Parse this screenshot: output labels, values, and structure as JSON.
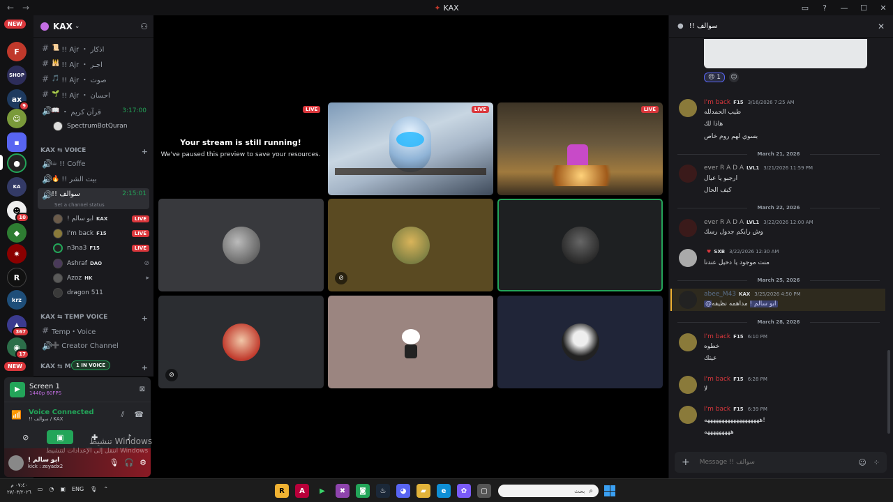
{
  "window": {
    "title": "KAX",
    "back_icon": "←",
    "forward_icon": "→"
  },
  "rail": {
    "new_badge_top": "NEW",
    "new_badge_bottom": "NEW",
    "badges": [
      "9",
      "10",
      "367",
      "17"
    ],
    "letters": [
      "F",
      "R",
      "krz"
    ]
  },
  "guild": {
    "name": "KAX"
  },
  "channels": [
    {
      "label": "!! Ajr ・ اذكار"
    },
    {
      "label": "!! Ajr ・ اجـر"
    },
    {
      "label": "!! Ajr ・ صوت"
    },
    {
      "label": "!! Ajr ・ احسان"
    },
    {
      "label": "・ قرآن كريم",
      "time": "3:17:00"
    }
  ],
  "bot_user": "SpectrumBotQuran",
  "categories": {
    "voice": "KAX ⇆ VOICE",
    "temp": "KAX ⇆ TEMP VOICE",
    "misc": "KAX ⇆ M"
  },
  "voice_channels": [
    {
      "label": "!! Coffe"
    },
    {
      "label": "!! بيت الشر"
    },
    {
      "label": "!! سوالف",
      "time": "2:15:01",
      "status": "Set a channel status"
    }
  ],
  "voice_users": [
    {
      "name": "! ابو سالم",
      "tag": "KAX",
      "badge": "LIVE"
    },
    {
      "name": "I'm back",
      "tag": "F15",
      "badge": "LIVE"
    },
    {
      "name": "n3na3",
      "tag": "F15",
      "badge": "LIVE"
    },
    {
      "name": "Ashraf",
      "tag": "DAO"
    },
    {
      "name": "Azoz",
      "tag": "HK"
    },
    {
      "name": "dragon 511"
    }
  ],
  "temp_channels": [
    {
      "label": "Temp・Voice"
    },
    {
      "label": "Creator Channel"
    }
  ],
  "in_voice_pill": "1 IN VOICE",
  "panel": {
    "screen_title": "Screen 1",
    "screen_sub": "1440p 60FPS",
    "voice_status": "Voice Connected",
    "voice_sub": "!! سوالف / KAX",
    "user_name": "! ابو سالم",
    "user_status": "kick : zeyadx2"
  },
  "watermark": {
    "line1": "تنشيط Windows",
    "line2": "انتقل إلى الإعدادات لتنشيط Windows"
  },
  "stage": {
    "paused_title": "Your stream is still running!",
    "paused_sub": "We've paused this preview to save your resources.",
    "live_label": "LIVE"
  },
  "chat": {
    "title": "!! سوالف",
    "reaction_count": "1",
    "messages": [
      {
        "name": "I'm back",
        "tag": "F15",
        "time": "3/16/2026 7:25 AM",
        "lines": [
          "طيب الحمدلله",
          "هاذا لك",
          "بسوي لهم روم خاص"
        ]
      },
      {
        "date": "March 21, 2026"
      },
      {
        "name": "ever R A D A",
        "tag": "LVL1",
        "time": "3/21/2026 11:59 PM",
        "lines": [
          "ارجبو يا عيال",
          "كيف الحال"
        ]
      },
      {
        "date": "March 22, 2026"
      },
      {
        "name": "ever R A D A",
        "tag": "LVL1",
        "time": "3/22/2026 12:00 AM",
        "lines": [
          "وش رايكم جدول رسك"
        ]
      },
      {
        "name": "",
        "tag": "SXB",
        "time": "3/22/2026 12:30 AM",
        "lines": [
          "منت موجود يا دخيل عندنا"
        ]
      },
      {
        "date": "March 25, 2026"
      },
      {
        "name": "abee_M43",
        "tag": "KAX",
        "time": "3/25/2026 4:50 PM",
        "mention": "@ابو سالم !",
        "lines": [
          "مداهمه نظيفه"
        ]
      },
      {
        "date": "March 28, 2026"
      },
      {
        "name": "I'm back",
        "tag": "F15",
        "time": "6:10 PM",
        "lines": [
          "خطوه",
          "عيتك"
        ]
      },
      {
        "name": "I'm back",
        "tag": "F15",
        "time": "6:28 PM",
        "lines": [
          "لا"
        ]
      },
      {
        "name": "I'm back",
        "tag": "F15",
        "time": "6:39 PM",
        "lines": [
          "هههههههههههههههههههه!",
          "هههههههههه"
        ]
      }
    ],
    "composer_placeholder": "Message !! سوالف"
  },
  "taskbar": {
    "time": "٠٧:٤٠ م",
    "date": "٢٧/٠٣/٢٠٢٦",
    "lang": "ENG",
    "search_placeholder": "بحث"
  },
  "colors": {
    "accent": "#5865f2",
    "live": "#da373c",
    "connected": "#23a559",
    "background": "#1a1a1e"
  }
}
